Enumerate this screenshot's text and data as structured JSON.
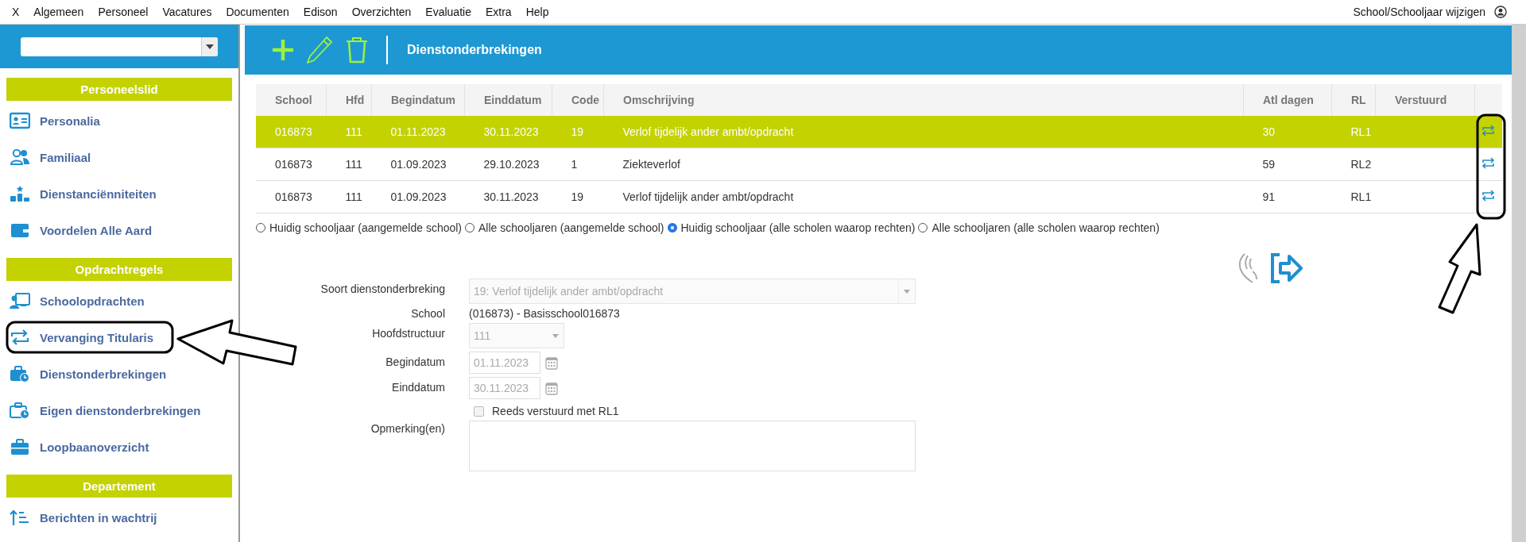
{
  "menu": {
    "items": [
      "X",
      "Algemeen",
      "Personeel",
      "Vacatures",
      "Documenten",
      "Edison",
      "Overzichten",
      "Evaluatie",
      "Extra",
      "Help"
    ],
    "right": "School/Schooljaar wijzigen"
  },
  "sidebar": {
    "sections": [
      {
        "title": "Personeelslid",
        "items": [
          {
            "label": "Personalia",
            "kind": "card"
          },
          {
            "label": "Familiaal",
            "kind": "people"
          },
          {
            "label": "Dienstanciënniteiten",
            "kind": "podium"
          },
          {
            "label": "Voordelen Alle Aard",
            "kind": "wallet"
          }
        ]
      },
      {
        "title": "Opdrachtregels",
        "items": [
          {
            "label": "Schoolopdrachten",
            "kind": "screen"
          },
          {
            "label": "Vervanging Titularis",
            "kind": "swap"
          },
          {
            "label": "Dienstonderbrekingen",
            "kind": "case-clock"
          },
          {
            "label": "Eigen dienstonderbrekingen",
            "kind": "case-clock-outline"
          },
          {
            "label": "Loopbaanoverzicht",
            "kind": "case"
          }
        ]
      },
      {
        "title": "Departement",
        "items": [
          {
            "label": "Berichten in wachtrij",
            "kind": "sort"
          }
        ]
      }
    ]
  },
  "header": {
    "title": "Dienstonderbrekingen"
  },
  "table": {
    "columns": [
      "School",
      "Hfd",
      "Begindatum",
      "Einddatum",
      "Code",
      "Omschrijving",
      "Atl dagen",
      "RL",
      "Verstuurd"
    ],
    "rows": [
      {
        "school": "016873",
        "hfd": "111",
        "begindatum": "01.11.2023",
        "einddatum": "30.11.2023",
        "code": "19",
        "omschrijving": "Verlof tijdelijk ander ambt/opdracht",
        "atl_dagen": "30",
        "rl": "RL1",
        "selected": true
      },
      {
        "school": "016873",
        "hfd": "111",
        "begindatum": "01.09.2023",
        "einddatum": "29.10.2023",
        "code": "1",
        "omschrijving": "Ziekteverlof",
        "atl_dagen": "59",
        "rl": "RL2",
        "selected": false
      },
      {
        "school": "016873",
        "hfd": "111",
        "begindatum": "01.09.2023",
        "einddatum": "30.11.2023",
        "code": "19",
        "omschrijving": "Verlof tijdelijk ander ambt/opdracht",
        "atl_dagen": "91",
        "rl": "RL1",
        "selected": false
      }
    ]
  },
  "filters": [
    {
      "label": "Huidig schooljaar (aangemelde school)",
      "selected": false
    },
    {
      "label": "Alle schooljaren (aangemelde school)",
      "selected": false
    },
    {
      "label": "Huidig schooljaar (alle scholen waarop rechten)",
      "selected": true
    },
    {
      "label": "Alle schooljaren (alle scholen waarop rechten)",
      "selected": false
    }
  ],
  "form": [
    {
      "kind": "select",
      "label": "Soort dienstonderbreking",
      "value": "19: Verlof tijdelijk ander ambt/opdracht",
      "disabled": true
    },
    {
      "kind": "text",
      "label": "School",
      "value": "(016873) - Basisschool016873"
    },
    {
      "kind": "select-small",
      "label": "Hoofdstructuur",
      "value": "111",
      "disabled": true
    },
    {
      "kind": "date",
      "label": "Begindatum",
      "value": "01.11.2023",
      "disabled": true
    },
    {
      "kind": "date",
      "label": "Einddatum",
      "value": "30.11.2023",
      "disabled": true
    },
    {
      "kind": "checkbox",
      "label": "Reeds verstuurd met RL1",
      "checked": false
    },
    {
      "kind": "textarea",
      "label": "Opmerking(en)"
    }
  ]
}
